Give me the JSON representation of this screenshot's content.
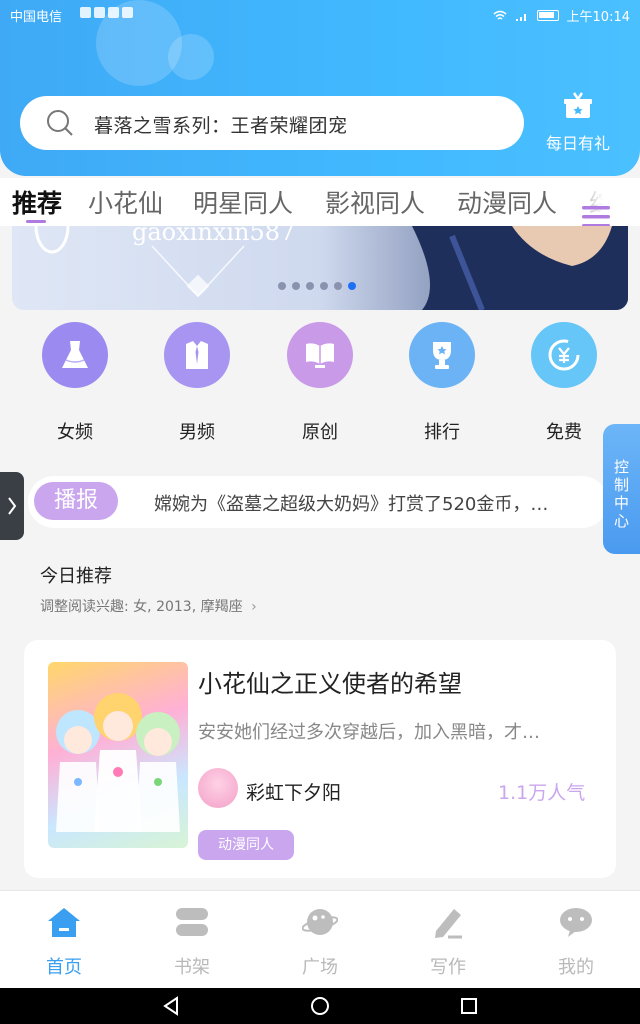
{
  "status_bar": {
    "carrier": "中国电信",
    "time": "上午10:14"
  },
  "search": {
    "text": "暮落之雪系列：王者荣耀团宠"
  },
  "gift": {
    "label": "每日有礼"
  },
  "tabs": [
    "推荐",
    "小花仙",
    "明星同人",
    "影视同人",
    "动漫同人",
    "综影"
  ],
  "banner": {
    "text": "gaoxinxin587",
    "page_count": 6,
    "active_index": 5
  },
  "categories": [
    {
      "label": "女频",
      "icon": "dress-icon",
      "color": "#9b8af0"
    },
    {
      "label": "男频",
      "icon": "shirt-icon",
      "color": "#a795f1"
    },
    {
      "label": "原创",
      "icon": "book-icon",
      "color": "#c89ae8"
    },
    {
      "label": "排行",
      "icon": "trophy-icon",
      "color": "#6bb3f5"
    },
    {
      "label": "免费",
      "icon": "coin-icon",
      "color": "#66c6f7"
    }
  ],
  "broadcast": {
    "badge": "播报",
    "text": "嫦婉为《盗墓之超级大奶妈》打赏了520金币，…"
  },
  "control_center": {
    "label": "控制中心"
  },
  "today": {
    "title": "今日推荐",
    "subtitle": "调整阅读兴趣: 女, 2013, 摩羯座"
  },
  "book": {
    "title": "小花仙之正义使者的希望",
    "description": "安安她们经过多次穿越后，加入黑暗，才…",
    "author": "彩虹下夕阳",
    "popularity": "1.1万人气",
    "tag": "动漫同人"
  },
  "bottom_nav": [
    {
      "label": "首页",
      "icon": "home-icon",
      "active": true
    },
    {
      "label": "书架",
      "icon": "bookshelf-icon",
      "active": false
    },
    {
      "label": "广场",
      "icon": "planet-icon",
      "active": false
    },
    {
      "label": "写作",
      "icon": "pen-icon",
      "active": false
    },
    {
      "label": "我的",
      "icon": "chat-icon",
      "active": false
    }
  ],
  "colors": {
    "header": "#41b9ff",
    "accent_purple": "#c9a6ee",
    "nav_active": "#3a9ff0"
  }
}
